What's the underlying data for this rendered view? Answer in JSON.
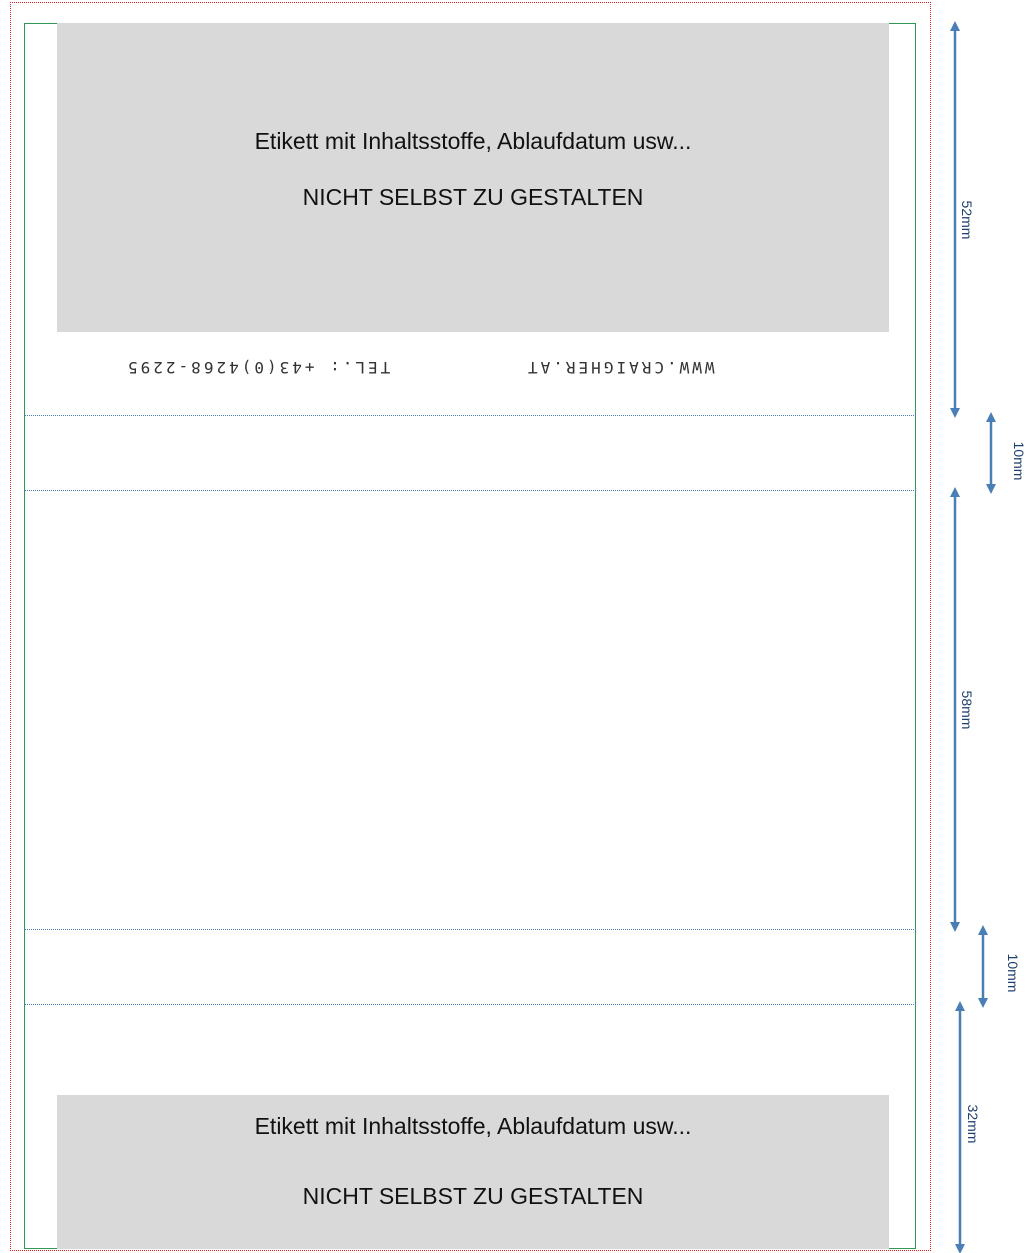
{
  "top_label": {
    "line1": "Etikett mit Inhaltsstoffe, Ablaufdatum usw...",
    "line2": "NICHT SELBST ZU GESTALTEN"
  },
  "bottom_label": {
    "line1": "Etikett mit Inhaltsstoffe, Ablaufdatum usw...",
    "line2": "NICHT SELBST ZU GESTALTEN"
  },
  "footer_flipped": {
    "website": "WWW.CRAIGHER.AT",
    "phone": "TEL.: +43(0)4268-2295"
  },
  "dimensions": [
    {
      "id": "dim-top",
      "label": "52mm"
    },
    {
      "id": "dim-fold-1",
      "label": "10mm"
    },
    {
      "id": "dim-middle",
      "label": "58mm"
    },
    {
      "id": "dim-fold-2",
      "label": "10mm"
    },
    {
      "id": "dim-bottom",
      "label": "32mm"
    }
  ],
  "colors": {
    "label_fill": "#d9d9d9",
    "bleed_line": "#e02020",
    "trim_line": "#2e9a55",
    "fold_line": "#4a7fb5",
    "arrow": "#4a7fb5"
  }
}
